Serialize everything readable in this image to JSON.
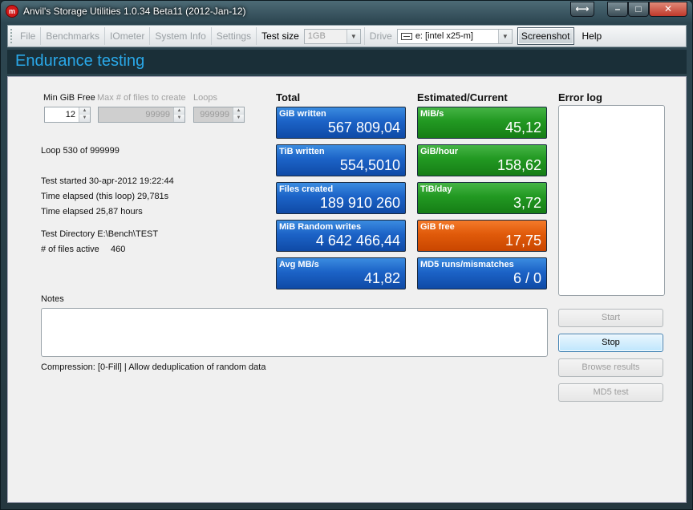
{
  "window": {
    "title": "Anvil's Storage Utilities 1.0.34 Beta11 (2012-Jan-12)",
    "app_icon_text": "m"
  },
  "menu": {
    "items": [
      "File",
      "Benchmarks",
      "IOmeter",
      "System Info",
      "Settings"
    ],
    "test_size_label": "Test size",
    "test_size_value": "1GB",
    "drive_label": "Drive",
    "drive_value": "e: [intel x25-m]",
    "screenshot_label": "Screenshot",
    "help_label": "Help"
  },
  "heading": "Endurance testing",
  "controls": {
    "min_free_label": "Min GiB Free",
    "min_free_value": "12",
    "max_files_label": "Max # of files to create",
    "max_files_value": "99999",
    "loops_label": "Loops",
    "loops_value": "999999"
  },
  "status": {
    "loop": "Loop 530 of 999999",
    "test_started": "Test started 30-apr-2012 19:22:44",
    "time_elapsed_loop": "Time elapsed (this loop) 29,781s",
    "time_elapsed": "Time elapsed 25,87 hours",
    "test_directory": "Test Directory E:\\Bench\\TEST",
    "files_active_label": "# of files active",
    "files_active_value": "460"
  },
  "total": {
    "heading": "Total",
    "tiles": [
      {
        "label": "GiB written",
        "value": "567 809,04",
        "color": "#1c63c7"
      },
      {
        "label": "TiB written",
        "value": "554,5010",
        "color": "#1c63c7"
      },
      {
        "label": "Files created",
        "value": "189 910 260",
        "color": "#1c63c7"
      },
      {
        "label": "MiB Random writes",
        "value": "4 642 466,44",
        "color": "#1c63c7"
      },
      {
        "label": "Avg MB/s",
        "value": "41,82",
        "color": "#1c63c7"
      }
    ]
  },
  "estimated": {
    "heading": "Estimated/Current",
    "tiles": [
      {
        "label": "MiB/s",
        "value": "45,12",
        "color": "#229922"
      },
      {
        "label": "GiB/hour",
        "value": "158,62",
        "color": "#229922"
      },
      {
        "label": "TiB/day",
        "value": "3,72",
        "color": "#229922"
      },
      {
        "label": "GiB free",
        "value": "17,75",
        "color": "#e05a0a"
      },
      {
        "label": "MD5 runs/mismatches",
        "value": "6 / 0",
        "color": "#1c63c7"
      }
    ]
  },
  "error_log": {
    "heading": "Error log"
  },
  "notes": {
    "label": "Notes",
    "compression": "Compression: [0-Fill]  | Allow deduplication of random data"
  },
  "buttons": {
    "start": "Start",
    "stop": "Stop",
    "browse": "Browse results",
    "md5": "MD5 test"
  },
  "icons": {
    "resize": "resize-horizontal-icon",
    "minimize": "minimize-icon",
    "maximize": "maximize-icon",
    "close": "close-icon",
    "drive": "drive-icon"
  }
}
